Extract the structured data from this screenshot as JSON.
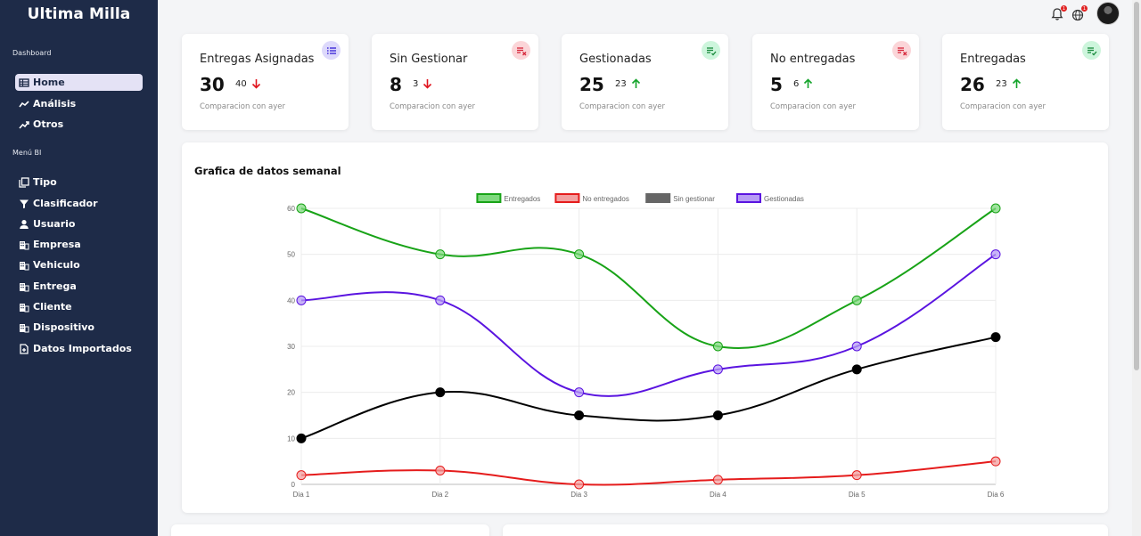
{
  "sidebar": {
    "brand": "Ultima Milla",
    "section_dashboard": "Dashboard",
    "section_bi": "Menú BI",
    "items": [
      {
        "label": "Home",
        "icon": "table-icon",
        "active": true
      },
      {
        "label": "Análisis",
        "icon": "trend-icon"
      },
      {
        "label": "Otros",
        "icon": "trend-up-icon"
      },
      {
        "label": "Tipo",
        "icon": "copy-icon"
      },
      {
        "label": "Clasificador",
        "icon": "filter-icon"
      },
      {
        "label": "Usuario",
        "icon": "user-icon"
      },
      {
        "label": "Empresa",
        "icon": "building-icon"
      },
      {
        "label": "Vehiculo",
        "icon": "building-icon"
      },
      {
        "label": "Entrega",
        "icon": "building-icon"
      },
      {
        "label": "Cliente",
        "icon": "building-icon"
      },
      {
        "label": "Dispositivo",
        "icon": "building-icon"
      },
      {
        "label": "Datos Importados",
        "icon": "file-plus-icon"
      }
    ]
  },
  "topbar": {
    "bell_count": "1",
    "globe_count": "1"
  },
  "cards": [
    {
      "title": "Entregas Asignadas",
      "value": "30",
      "compare": "40",
      "trend": "down",
      "foot": "Comparacion con ayer",
      "badge_icon": "list-icon",
      "badge_color": "#ddd9fb",
      "badge_fg": "#3f2bd8"
    },
    {
      "title": "Sin Gestionar",
      "value": "8",
      "compare": "3",
      "trend": "down",
      "foot": "Comparacion con ayer",
      "badge_icon": "list-x-icon",
      "badge_color": "#fbd5d8",
      "badge_fg": "#d6263a"
    },
    {
      "title": "Gestionadas",
      "value": "25",
      "compare": "23",
      "trend": "up",
      "foot": "Comparacion con ayer",
      "badge_icon": "list-check-icon",
      "badge_color": "#cdf5dc",
      "badge_fg": "#198a3c"
    },
    {
      "title": "No entregadas",
      "value": "5",
      "compare": "6",
      "trend": "up",
      "foot": "Comparacion con ayer",
      "badge_icon": "list-x-icon",
      "badge_color": "#fbd5d8",
      "badge_fg": "#d6263a"
    },
    {
      "title": "Entregadas",
      "value": "26",
      "compare": "23",
      "trend": "up",
      "foot": "Comparacion con ayer",
      "badge_icon": "list-check-icon",
      "badge_color": "#cdf5dc",
      "badge_fg": "#198a3c"
    }
  ],
  "colors": {
    "down": "#e0141e",
    "up": "#12a329"
  },
  "panel": {
    "title": "Grafica de datos semanal"
  },
  "chart_data": {
    "type": "line",
    "title": "Grafica de datos semanal",
    "x": [
      "Dia 1",
      "Dia 2",
      "Dia 3",
      "Dia 4",
      "Dia 5",
      "Dia 6"
    ],
    "ylim": [
      0,
      60
    ],
    "yticks": [
      0,
      10,
      20,
      30,
      40,
      50,
      60
    ],
    "grid": true,
    "legend_position": "top",
    "series": [
      {
        "name": "Entregados",
        "values": [
          60,
          50,
          50,
          30,
          40,
          60
        ],
        "color": "#18a317",
        "fill": "#7fd97e"
      },
      {
        "name": "No entregados",
        "values": [
          2,
          3,
          0,
          1,
          2,
          5
        ],
        "color": "#e51c1c",
        "fill": "#f3a0a0"
      },
      {
        "name": "Sin gestionar",
        "values": [
          10,
          20,
          15,
          15,
          25,
          32
        ],
        "color": "#000000",
        "fill": "#000000"
      },
      {
        "name": "Gestionadas",
        "values": [
          40,
          40,
          20,
          25,
          30,
          50
        ],
        "color": "#5a14e0",
        "fill": "#b79cf5"
      }
    ]
  }
}
